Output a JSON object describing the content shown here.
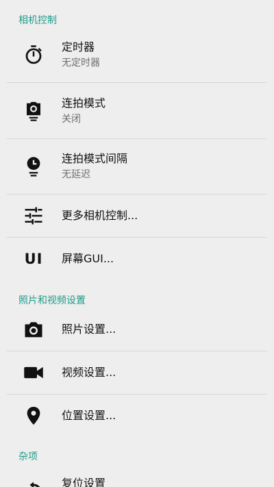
{
  "sections": {
    "camera_controls": {
      "header": "相机控制",
      "items": [
        {
          "title": "定时器",
          "summary": "无定时器",
          "icon": "timer-icon"
        },
        {
          "title": "连拍模式",
          "summary": "关闭",
          "icon": "burst-mode-icon"
        },
        {
          "title": "连拍模式间隔",
          "summary": "无延迟",
          "icon": "burst-interval-icon"
        },
        {
          "title": "更多相机控制...",
          "icon": "tune-sliders-icon"
        },
        {
          "title": "屏幕GUI...",
          "icon": "ui-icon",
          "icon_text": "UI"
        }
      ]
    },
    "photo_video": {
      "header": "照片和视频设置",
      "items": [
        {
          "title": "照片设置...",
          "icon": "camera-icon"
        },
        {
          "title": "视频设置...",
          "icon": "videocam-icon"
        },
        {
          "title": "位置设置...",
          "icon": "location-pin-icon"
        }
      ]
    },
    "misc": {
      "header": "杂项",
      "items": [
        {
          "title": "复位设置",
          "icon": "reset-icon"
        }
      ]
    }
  },
  "colors": {
    "background": "#eeeeee",
    "accent": "#1f9b8a",
    "title_text": "#111111",
    "summary_text": "#6f6f6f",
    "divider": "#d6d6d6"
  }
}
